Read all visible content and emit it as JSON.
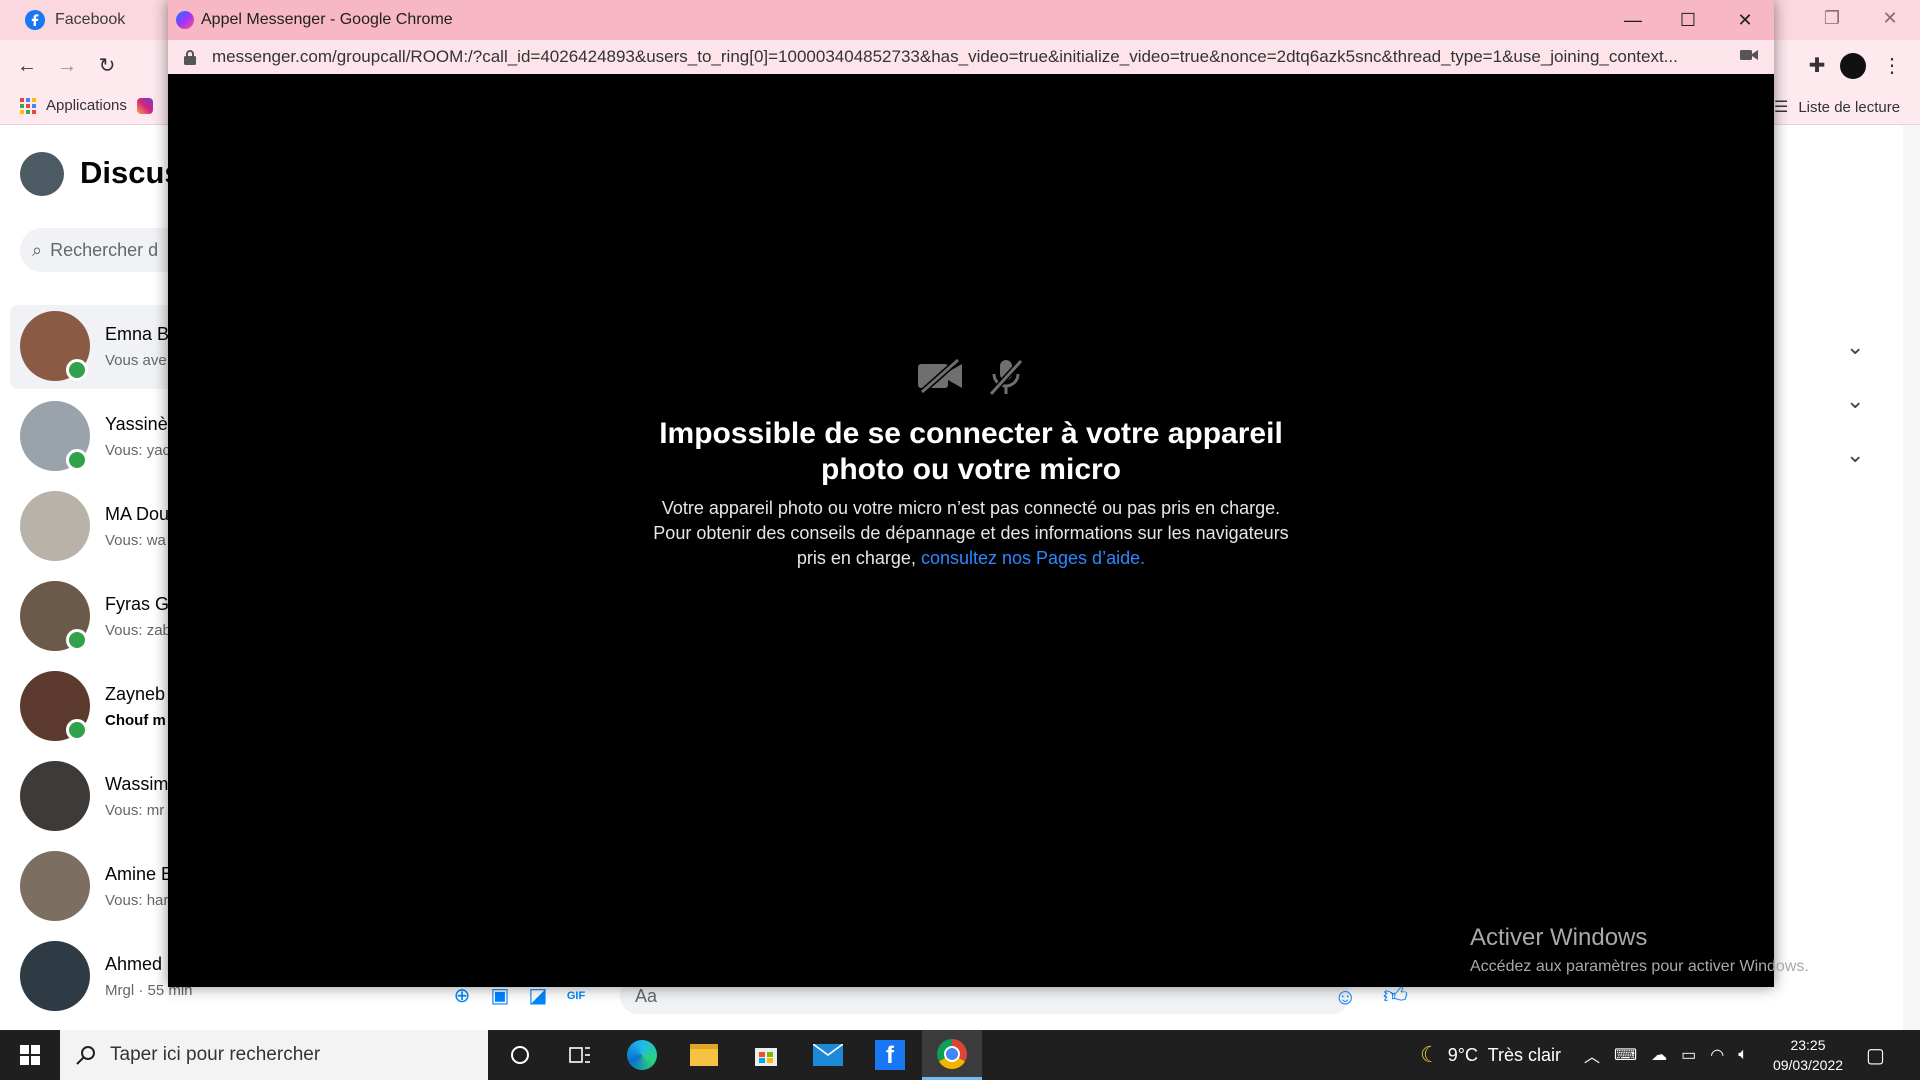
{
  "background_window": {
    "tab_title": "Facebook",
    "bookmarks": {
      "apps_label": "Applications",
      "reading_list_label": "Liste de lecture"
    },
    "sidebar_title": "Discus",
    "search_placeholder": "Rechercher d",
    "conversations": [
      {
        "name": "Emna B",
        "snippet": "Vous ave",
        "online": true,
        "active": true,
        "bold": false,
        "color": "#8a5a44"
      },
      {
        "name": "Yassinè",
        "snippet": "Vous: yac",
        "online": true,
        "active": false,
        "bold": false,
        "color": "#9aa3ab"
      },
      {
        "name": "MA Dou",
        "snippet": "Vous: wa",
        "online": false,
        "active": false,
        "bold": false,
        "color": "#b9b2a8"
      },
      {
        "name": "Fyras Gl",
        "snippet": "Vous: zab",
        "online": true,
        "active": false,
        "bold": false,
        "color": "#6b5a49"
      },
      {
        "name": "Zayneb",
        "snippet": "Chouf m",
        "online": true,
        "active": false,
        "bold": true,
        "color": "#5c3b2e"
      },
      {
        "name": "Wassim",
        "snippet": "Vous: mr",
        "online": false,
        "active": false,
        "bold": false,
        "color": "#3d3a38"
      },
      {
        "name": "Amine E",
        "snippet": "Vous: har",
        "online": false,
        "active": false,
        "bold": false,
        "color": "#7c6f62"
      },
      {
        "name": "Ahmed",
        "snippet": "Mrgl · 55 min",
        "online": false,
        "active": false,
        "bold": false,
        "color": "#2e3a44"
      }
    ],
    "composer_placeholder": "Aa",
    "watermark": {
      "title": "Activer Windows",
      "subtitle": "Accédez aux paramètres pour activer Windows."
    }
  },
  "popup": {
    "title": "Appel Messenger - Google Chrome",
    "url": "messenger.com/groupcall/ROOM:/?call_id=4026424893&users_to_ring[0]=100003404852733&has_video=true&initialize_video=true&nonce=2dtq6azk5snc&thread_type=1&use_joining_context...",
    "error_title": "Impossible de se connecter à votre appareil photo ou votre micro",
    "error_body": "Votre appareil photo ou votre micro n’est pas connecté ou pas pris en charge. Pour obtenir des conseils de dépannage et des informations sur les navigateurs pris en charge, ",
    "error_link": "consultez nos Pages d’aide."
  },
  "taskbar": {
    "search_placeholder": "Taper ici pour rechercher",
    "weather": "9°C  Très clair",
    "time": "23:25",
    "date": "09/03/2022"
  },
  "colors": {
    "popup_titlebar": "#f8b7c4",
    "online": "#31a24c",
    "messenger_blue": "#0084ff",
    "link": "#2d88ff"
  }
}
